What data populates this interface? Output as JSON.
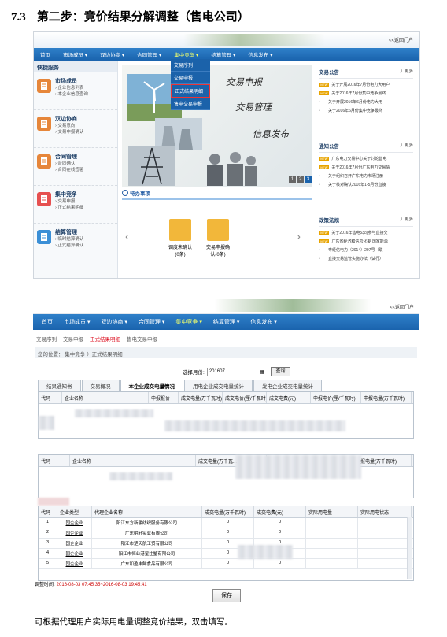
{
  "heading": {
    "number": "7.3",
    "title": "第二步：竞价结果分解调整（售电公司）"
  },
  "shot1": {
    "login_link": "<<返回门户",
    "nav": [
      "首页",
      "市场成员 ▾",
      "双边协商 ▾",
      "合同管理 ▾",
      "集中竞争 ▾",
      "结算管理 ▾",
      "信息发布 ▾"
    ],
    "dropdown": [
      "交易序列",
      "交易申报",
      "正式结果明细",
      "售电交易申报"
    ],
    "quick_title": "快捷服务",
    "quick_items": [
      {
        "title": "市场成员",
        "subs": [
          "› 企业信息列表",
          "› 本企业信息查询"
        ],
        "color": "#e6863a"
      },
      {
        "title": "双边协商",
        "subs": [
          "› 交易意向",
          "› 交易申报确认"
        ],
        "color": "#e6863a"
      },
      {
        "title": "合同管理",
        "subs": [
          "› 合同确认",
          "› 合同在线签署"
        ],
        "color": "#e6863a"
      },
      {
        "title": "集中竞争",
        "subs": [
          "› 交易申报",
          "› 正式结果明细"
        ],
        "color": "#e65050"
      },
      {
        "title": "结算管理",
        "subs": [
          "› 临时结算确认",
          "› 正式结算确认"
        ],
        "color": "#3b8fd6"
      }
    ],
    "slogans": [
      "交易申报",
      "交易管理",
      "信息发布"
    ],
    "slide_numbers": [
      "1",
      "2",
      "3"
    ],
    "todo_title": "待办事项",
    "todo_items": [
      {
        "l1": "调度未确认",
        "l2": "(0条)"
      },
      {
        "l1": "交易申报确",
        "l2": "认(0条)"
      }
    ],
    "arrows": [
      "‹",
      "›"
    ],
    "boxes": [
      {
        "title": "交易公告",
        "more": "》更多",
        "items": [
          {
            "new": true,
            "text": "关于开展2016年7月份电力大用户"
          },
          {
            "new": true,
            "text": "关于2016年7月份集中竞争最终"
          },
          {
            "new": false,
            "text": "关于开展2016年6月份电力大用"
          },
          {
            "new": false,
            "text": "关于2016年6月份集中竞争最终"
          }
        ]
      },
      {
        "title": "通知公告",
        "more": "》更多",
        "items": [
          {
            "new": true,
            "text": "广东电力交易中心关于讨论售电"
          },
          {
            "new": true,
            "text": "关于2016年7月份广东电力交易情"
          },
          {
            "new": false,
            "text": "关于组织召开广东电力市场注册"
          },
          {
            "new": false,
            "text": "关于核对确认2016年1-5月份直接"
          }
        ]
      },
      {
        "title": "政策法规",
        "more": "》更多",
        "items": [
          {
            "new": true,
            "text": "关于2016年售电公司参与直接交"
          },
          {
            "new": true,
            "text": "广东省经济和信息化委 国家能源"
          },
          {
            "new": false,
            "text": "粤经信电力（2014）297号（联"
          },
          {
            "new": false,
            "text": "直接交易监管实施办法（试行）"
          }
        ]
      }
    ]
  },
  "shot2": {
    "login_link": "<<返回门户",
    "nav": [
      "首页",
      "市场成员 ▾",
      "双边协商 ▾",
      "合同管理 ▾",
      "集中竞争 ▾",
      "结算管理 ▾",
      "信息发布 ▾"
    ],
    "subtabs": [
      "交易序列",
      "交易申报",
      "正式结果明细",
      "售电交易申报"
    ],
    "breadcrumb": "您的位置：   集中竞争  〉正式结果明细",
    "select_label": "选择月份:",
    "select_value": "201607",
    "query_button": "查询",
    "tabs": [
      "结果通知书",
      "交易概况",
      "本企业成交电量情况",
      "用电企业成交电量统计",
      "发电企业成交电量统计"
    ],
    "grid1_headers": [
      "代码",
      "企业名称",
      "申报报价",
      "成交电量(万千瓦时)",
      "成交电价(厘/千瓦时)",
      "成交电费(元)",
      "申报电价(厘/千瓦时)",
      "申报电量(万千瓦时)"
    ],
    "grid2_headers": [
      "代码",
      "企业名称",
      "成交电量(万千瓦...",
      "",
      "申报电量(万千瓦时)"
    ],
    "grid3_headers": [
      "代码",
      "企业类型",
      "代理企业名称",
      "成交电量(万千瓦时)",
      "成交电费(元)",
      "实际用电量",
      "实际用电状态"
    ],
    "grid3_rows": [
      [
        "1",
        "国企企业",
        "阳江东方新骏纺织服务有限公司",
        "0",
        "0",
        "",
        ""
      ],
      [
        "2",
        "国企企业",
        "广东明轩实业有限公司",
        "0",
        "0",
        "",
        ""
      ],
      [
        "3",
        "国企企业",
        "阳江市楚天航工贸有限公司",
        "0",
        "0",
        "",
        ""
      ],
      [
        "4",
        "国企企业",
        "阳江市恒业港星注塑有限公司",
        "0",
        "0",
        "",
        ""
      ],
      [
        "5",
        "国企企业",
        "广东和盈丰鲜食品有限公司",
        "0",
        "0",
        "",
        ""
      ]
    ],
    "adjust_label": "调整时间:",
    "adjust_value": "2016-08-03 07:45:35~2016-08-03 19:45:41",
    "save_button": "保存"
  },
  "caption": "可根据代理用户实际用电量调整竞价结果，双击填写。"
}
